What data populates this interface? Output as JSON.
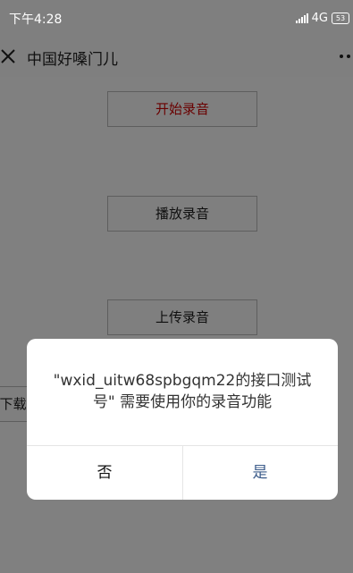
{
  "status_bar": {
    "time": "下午4:28",
    "network": "4G",
    "battery": "53"
  },
  "nav": {
    "title": "中国好嗓门儿",
    "close_icon": "close-icon",
    "more_icon": "more-icon"
  },
  "page": {
    "start_label": "开始录音",
    "play_label": "播放录音",
    "upload_label": "上传录音",
    "download_label": "下载录"
  },
  "dialog": {
    "message": "\"wxid_uitw68spbgqm22的接口测试号\" 需要使用你的录音功能",
    "deny_label": "否",
    "allow_label": "是"
  },
  "colors": {
    "overlay": "#7f7f7f",
    "accent_start": "#6a0000",
    "allow_text": "#3b5b8a"
  }
}
